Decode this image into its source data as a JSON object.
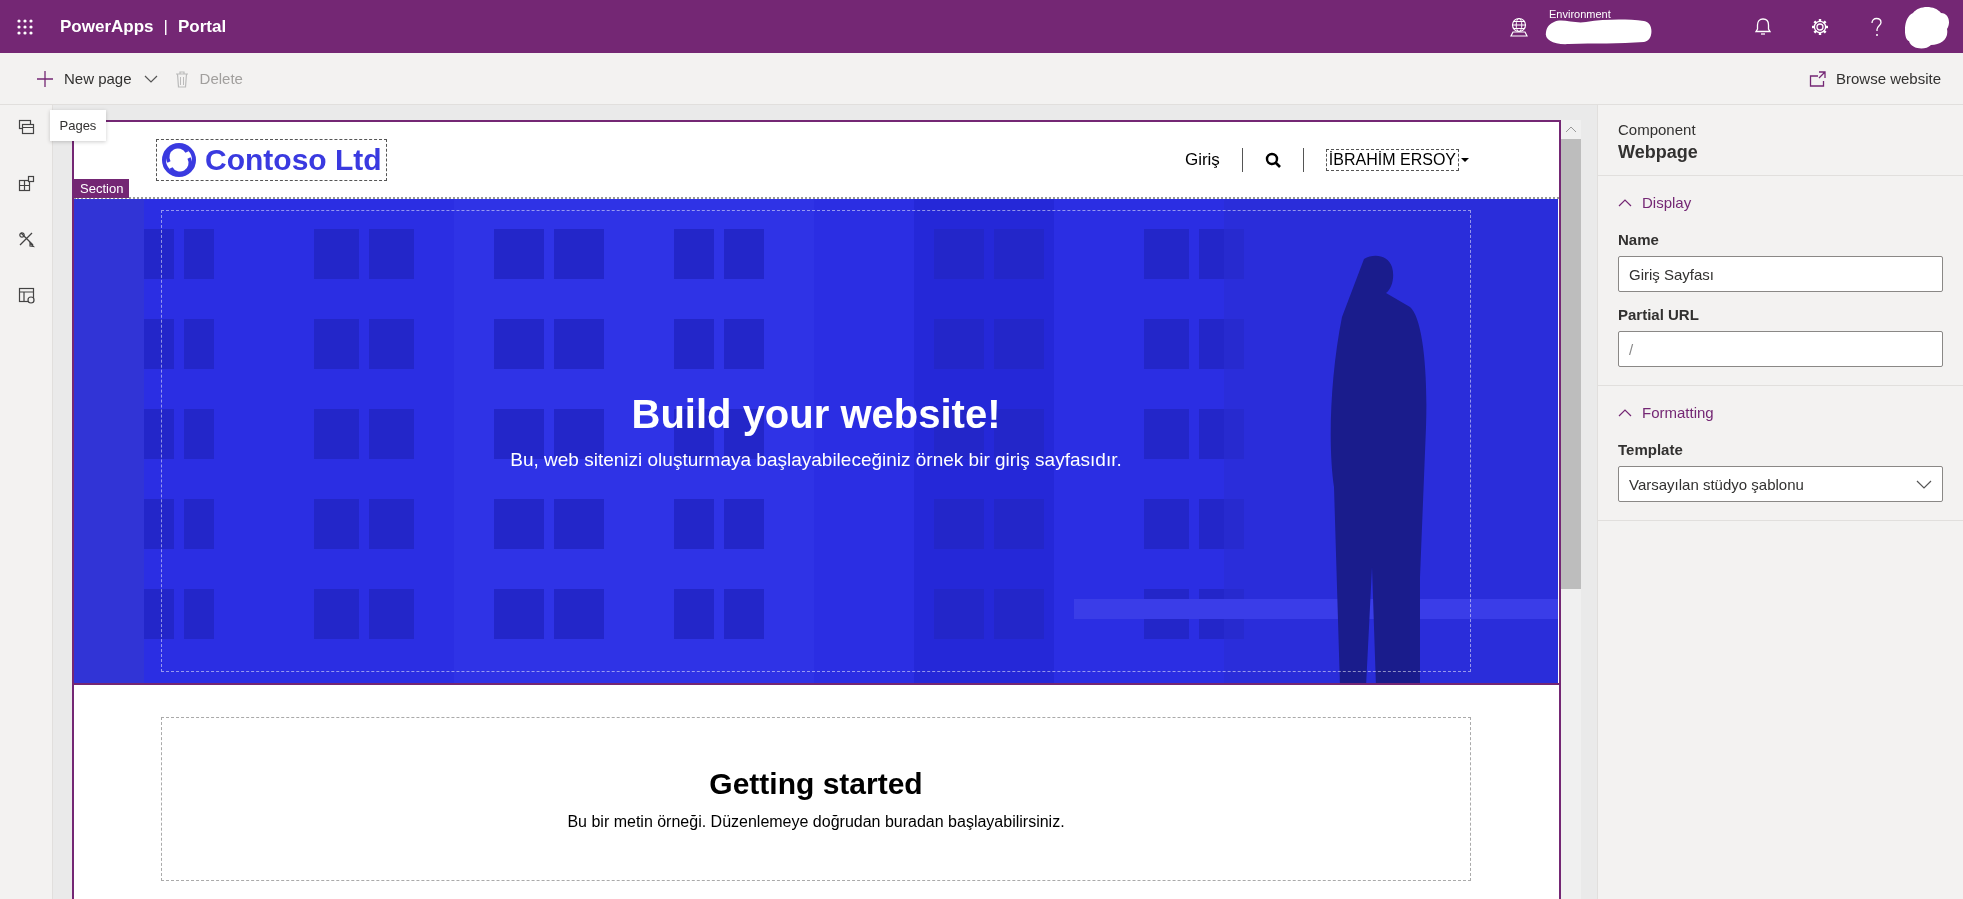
{
  "top_bar": {
    "app_name": "PowerApps",
    "separator": "|",
    "section": "Portal",
    "environment_label": "Environment"
  },
  "command_bar": {
    "items": [
      {
        "label": "New page",
        "kind": "dropdown",
        "disabled": false
      },
      {
        "label": "Delete",
        "kind": "delete",
        "disabled": true
      }
    ],
    "browse": "Browse website"
  },
  "left_rail": {
    "items": [
      {
        "kind": "pages",
        "tooltip": "Pages"
      },
      {
        "kind": "components"
      },
      {
        "kind": "themes"
      },
      {
        "kind": "templates"
      }
    ]
  },
  "site": {
    "logo": "Contoso Ltd",
    "nav": [
      {
        "kind": "link",
        "label": "Giriş"
      },
      {
        "kind": "search"
      },
      {
        "kind": "user",
        "label": "İBRAHİM ERSOY"
      }
    ],
    "section_tag": "Section",
    "hero": {
      "title": "Build your website!",
      "subtitle": "Bu, web sitenizi oluşturmaya başlayabileceğiniz örnek bir giriş sayfasıdır."
    },
    "intro": {
      "title": "Getting started",
      "text": "Bu bir metin örneği. Düzenlemeye doğrudan buradan başlayabilirsiniz."
    }
  },
  "properties": {
    "component_label": "Component",
    "component": "Webpage",
    "groups": [
      {
        "title": "Display",
        "expanded": true,
        "fields": [
          {
            "label": "Name",
            "kind": "text",
            "value": "Giriş Sayfası"
          },
          {
            "label": "Partial URL",
            "kind": "text",
            "placeholder": "/"
          }
        ]
      },
      {
        "title": "Formatting",
        "expanded": true,
        "fields": [
          {
            "label": "Template",
            "kind": "select",
            "value": "Varsayılan stüdyo şablonu"
          }
        ]
      }
    ]
  }
}
